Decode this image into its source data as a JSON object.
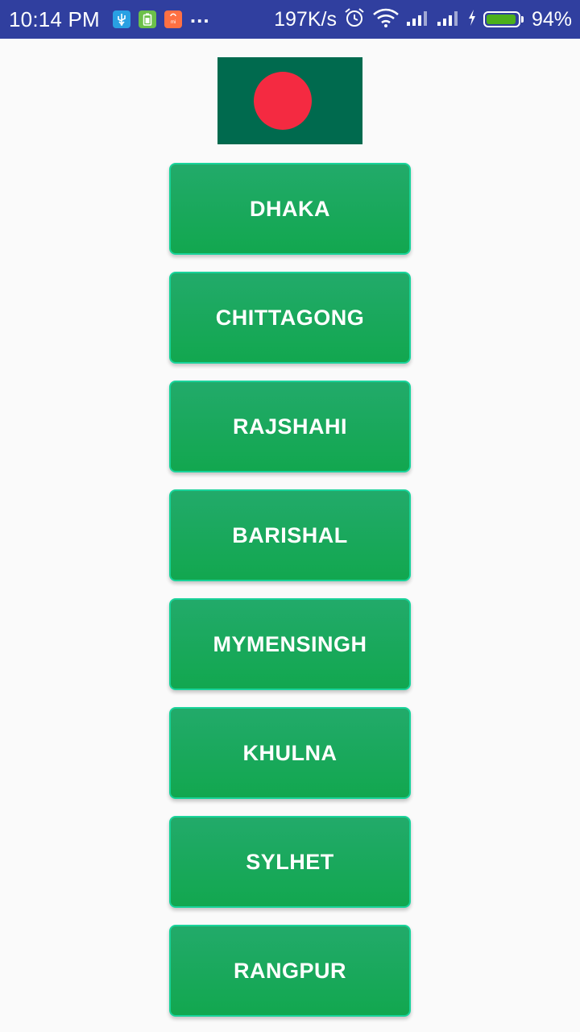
{
  "status_bar": {
    "time": "10:14 PM",
    "notification_icons": [
      "usb-icon",
      "battery-app-icon",
      "shop-bag-icon"
    ],
    "more_indicator": "...",
    "network_speed": "197K/s",
    "battery_percent": "94%",
    "battery_level": 0.94,
    "colors": {
      "background": "#303f9f",
      "battery_fill": "#4caf1c"
    }
  },
  "flag": {
    "icon": "bangladesh-flag",
    "colors": {
      "field": "#006a4e",
      "disc": "#f42a41"
    }
  },
  "divisions": [
    {
      "label": "DHAKA"
    },
    {
      "label": "CHITTAGONG"
    },
    {
      "label": "RAJSHAHI"
    },
    {
      "label": "BARISHAL"
    },
    {
      "label": "MYMENSINGH"
    },
    {
      "label": "KHULNA"
    },
    {
      "label": "SYLHET"
    },
    {
      "label": "RANGPUR"
    }
  ],
  "theme": {
    "button_top": "#22aa6a",
    "button_bottom": "#12a74f",
    "button_border": "#19d39a",
    "page_background": "#fafafa"
  }
}
